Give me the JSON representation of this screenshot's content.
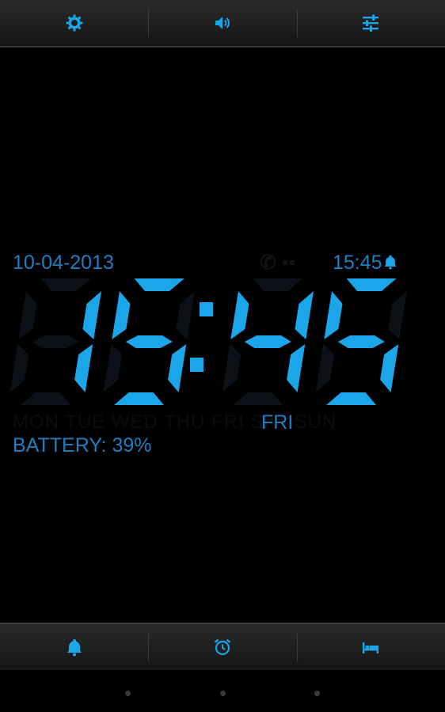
{
  "top_bar": {
    "buttons": [
      {
        "icon": "gear-icon"
      },
      {
        "icon": "speaker-icon"
      },
      {
        "icon": "sliders-icon"
      }
    ]
  },
  "clock_face": {
    "date": "10-04-2013",
    "alarm_time": "15:45",
    "time": "15:45",
    "day": "FRI",
    "battery": "BATTERY: 39%",
    "digit_color": "#1aa6e8",
    "label_color": "#1f7ec0"
  },
  "bottom_bar": {
    "buttons": [
      {
        "icon": "bell-icon"
      },
      {
        "icon": "alarm-clock-icon"
      },
      {
        "icon": "bed-icon"
      }
    ]
  },
  "colors": {
    "accent": "#1aa6e8",
    "background": "#000000",
    "bar": "#1f1f1f"
  }
}
